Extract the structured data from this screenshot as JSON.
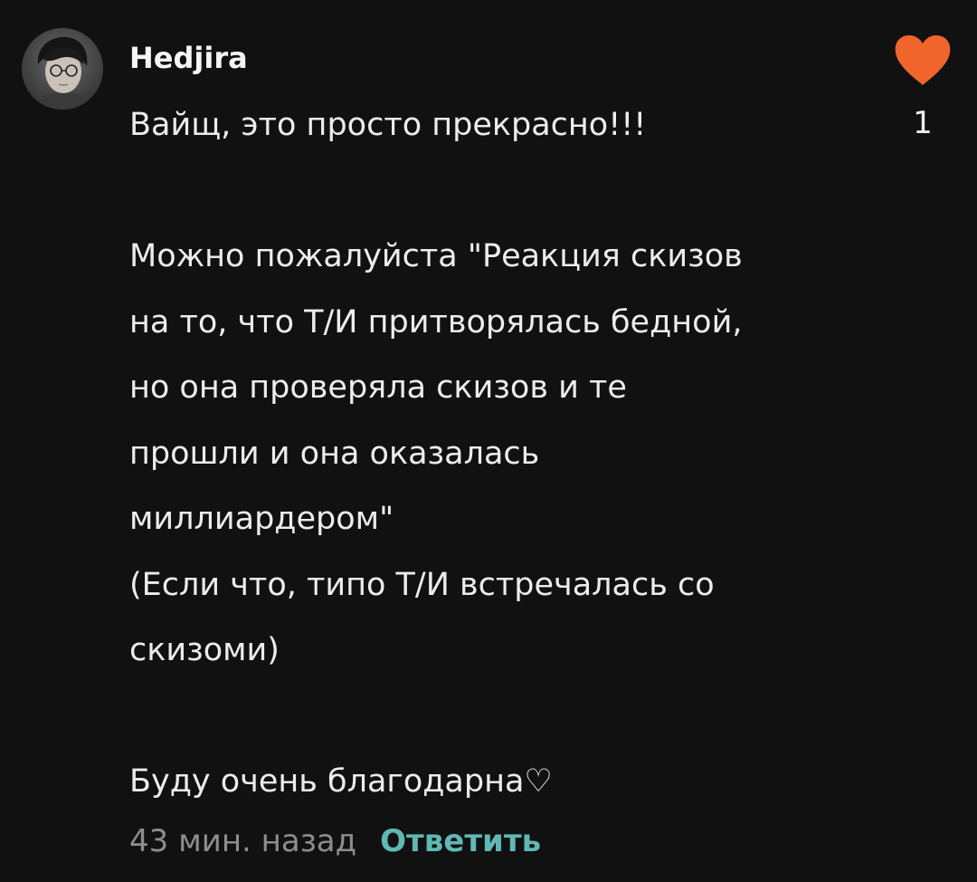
{
  "comment": {
    "author": {
      "username": "Hedjira",
      "avatar_icon": "user-avatar-photo"
    },
    "text": "Вайщ, это просто прекрасно!!!\n\nМожно пожалуйста \"Реакция скизов\nна то, что Т/И притворялась бедной,\nно она проверяла скизов и те\nпрошли и она оказалась\nмиллиардером\"\n(Если что, типо Т/И встречалась со\nскизоми)\n\nБуду очень благодарна♡",
    "timestamp": "43 мин. назад",
    "reply_label": "Ответить",
    "like": {
      "icon": "heart-icon",
      "count": "1",
      "liked": true
    }
  },
  "colors": {
    "background": "#111111",
    "text": "#ececec",
    "timestamp": "#8d8d8d",
    "reply": "#5fb8b4",
    "heart": "#f0652c"
  }
}
